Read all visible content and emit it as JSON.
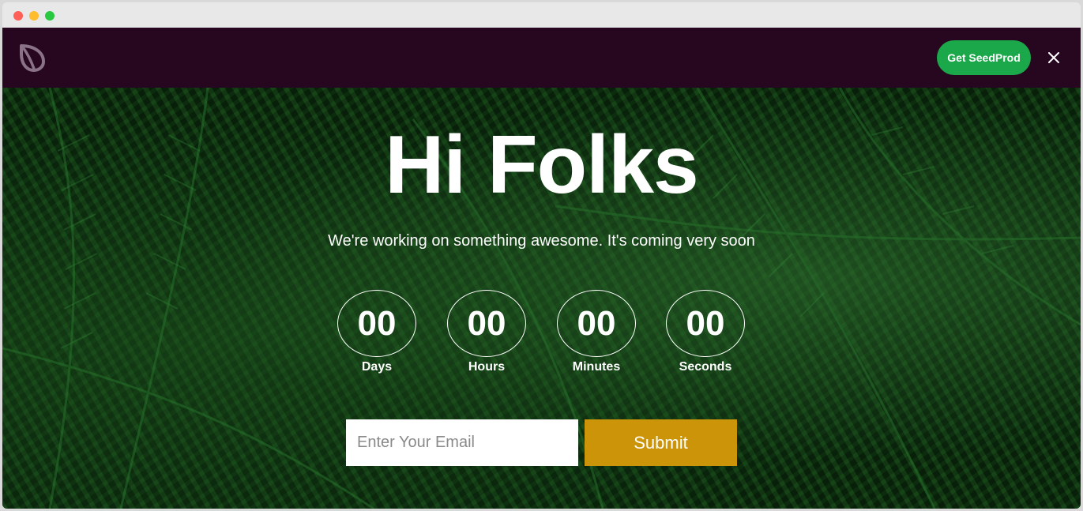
{
  "topbar": {
    "logo_icon": "seedprod-leaf-icon",
    "cta_label": "Get SeedProd",
    "close_icon": "close-icon"
  },
  "hero": {
    "headline": "Hi Folks",
    "subtitle": "We're working on something awesome. It's coming very soon"
  },
  "countdown": [
    {
      "value": "00",
      "label": "Days"
    },
    {
      "value": "00",
      "label": "Hours"
    },
    {
      "value": "00",
      "label": "Minutes"
    },
    {
      "value": "00",
      "label": "Seconds"
    }
  ],
  "form": {
    "email_placeholder": "Enter Your Email",
    "email_value": "",
    "submit_label": "Submit"
  },
  "colors": {
    "topbar_bg": "#270720",
    "cta_bg": "#1ba84a",
    "submit_bg": "#cc9409",
    "background": "#0f3314"
  }
}
